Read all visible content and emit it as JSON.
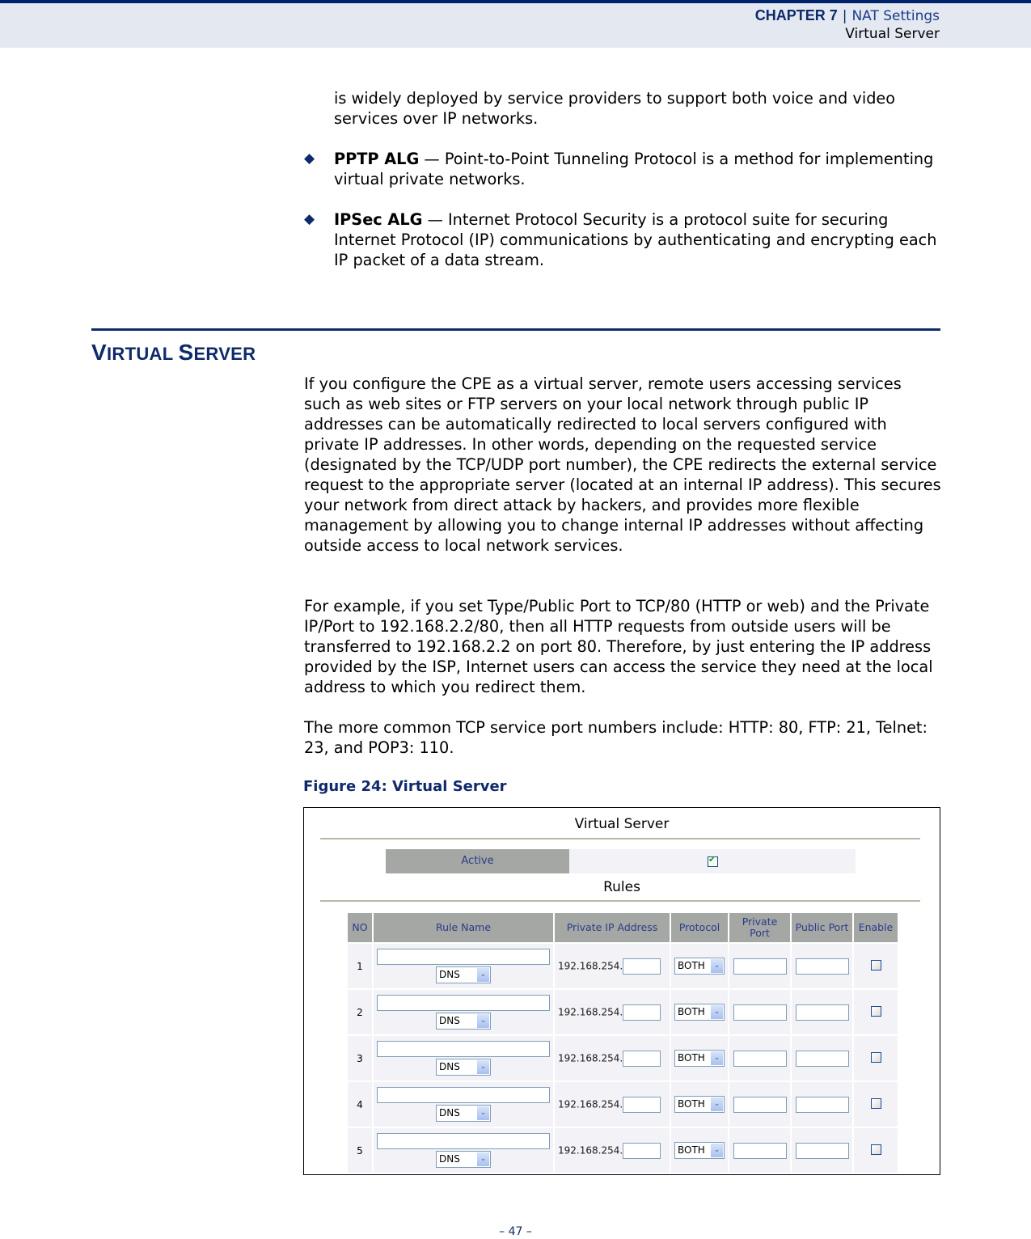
{
  "header": {
    "chapter": "CHAPTER 7",
    "separator": "|",
    "section": "NAT Settings",
    "subsection": "Virtual Server"
  },
  "intro_continuation": "is widely deployed by service providers to support both voice and video services over IP networks.",
  "bullets": [
    {
      "term": "PPTP ALG",
      "text": " — Point-to-Point Tunneling Protocol is a method for implementing virtual private networks."
    },
    {
      "term": "IPSec ALG",
      "text": " — Internet Protocol Security is a protocol suite for securing Internet Protocol (IP) communications by authenticating and encrypting each IP packet of a data stream."
    }
  ],
  "section": {
    "title_first_initial": "V",
    "title_first_rest": "IRTUAL ",
    "title_second_initial": "S",
    "title_second_rest": "ERVER",
    "paragraphs": [
      "If you configure the CPE as a virtual server, remote users accessing services such as web sites or FTP servers on your local network through public IP addresses can be automatically redirected to local servers configured with private IP addresses. In other words, depending on the requested service (designated by the TCP/UDP port number), the CPE redirects the external service request to the appropriate server (located at an internal IP address). This secures your network from direct attack by hackers, and provides more flexible management by allowing you to change internal IP addresses without affecting outside access to local network services.",
      "For example, if you set Type/Public Port to TCP/80 (HTTP or web) and the Private IP/Port to 192.168.2.2/80, then all HTTP requests from outside users will be transferred to 192.168.2.2 on port 80. Therefore, by just entering the IP address provided by the ISP, Internet users can access the service they need at the local address to which you redirect them.",
      "The more common TCP service port numbers include: HTTP: 80, FTP: 21, Telnet: 23, and POP3: 110."
    ],
    "figure_caption": "Figure 24:  Virtual Server"
  },
  "figure": {
    "title": "Virtual Server",
    "active_label": "Active",
    "active_checked": true,
    "rules_title": "Rules",
    "columns": [
      "NO",
      "Rule Name",
      "Private IP Address",
      "Protocol",
      "Private Port",
      "Public Port",
      "Enable"
    ],
    "rows": [
      {
        "no": "1",
        "rule_name": "",
        "service": "DNS",
        "ip_prefix": "192.168.254.",
        "ip_suffix": "",
        "protocol": "BOTH",
        "private_port": "",
        "public_port": "",
        "enabled": false
      },
      {
        "no": "2",
        "rule_name": "",
        "service": "DNS",
        "ip_prefix": "192.168.254.",
        "ip_suffix": "",
        "protocol": "BOTH",
        "private_port": "",
        "public_port": "",
        "enabled": false
      },
      {
        "no": "3",
        "rule_name": "",
        "service": "DNS",
        "ip_prefix": "192.168.254.",
        "ip_suffix": "",
        "protocol": "BOTH",
        "private_port": "",
        "public_port": "",
        "enabled": false
      },
      {
        "no": "4",
        "rule_name": "",
        "service": "DNS",
        "ip_prefix": "192.168.254.",
        "ip_suffix": "",
        "protocol": "BOTH",
        "private_port": "",
        "public_port": "",
        "enabled": false
      },
      {
        "no": "5",
        "rule_name": "",
        "service": "DNS",
        "ip_prefix": "192.168.254.",
        "ip_suffix": "",
        "protocol": "BOTH",
        "private_port": "",
        "public_port": "",
        "enabled": false
      }
    ]
  },
  "page_number": "–  47  –",
  "colors": {
    "brand_navy": "#0f2a6a",
    "header_band": "#e4e8f1",
    "table_header_bg": "#a5a7a4",
    "table_header_text": "#2a3c8a",
    "table_cell_bg": "#f3f2f6"
  }
}
